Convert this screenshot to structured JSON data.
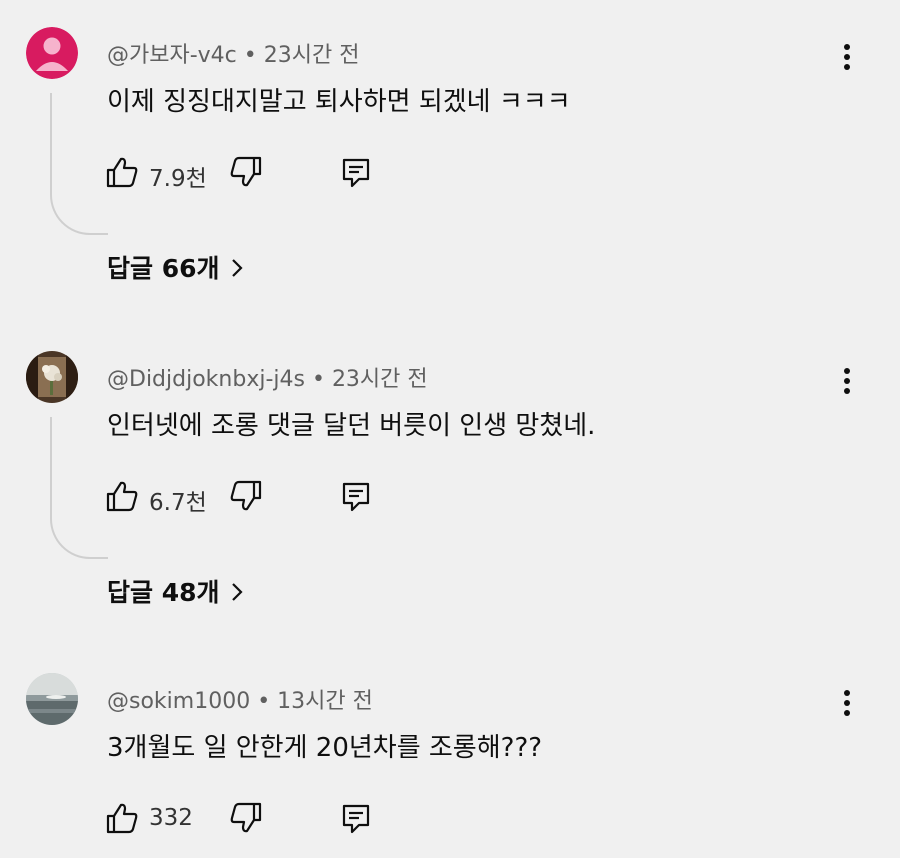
{
  "comments": [
    {
      "author": "@가보자-v4c",
      "time": "23시간 전",
      "text": "이제 징징대지말고 퇴사하면 되겠네 ㅋㅋㅋ",
      "likes": "7.9천",
      "replies": "답글 66개",
      "avatar": "default-person-avatar",
      "avatar_color": "#d81b60"
    },
    {
      "author": "@Didjdjoknbxj-j4s",
      "time": "23시간 전",
      "text": "인터넷에 조롱 댓글 달던 버릇이 인생 망쳤네.",
      "likes": "6.7천",
      "replies": "답글 48개",
      "avatar": "flower-photo-avatar"
    },
    {
      "author": "@sokim1000",
      "time": "13시간 전",
      "text": "3개월도 일 안한게 20년차를 조롱해???",
      "likes": "332",
      "avatar": "sea-photo-avatar"
    }
  ],
  "separator": " • ",
  "icons": {
    "like": "thumbs-up-icon",
    "dislike": "thumbs-down-icon",
    "reply": "reply-comment-icon",
    "more": "more-vertical-icon",
    "chevron": "chevron-right-icon"
  }
}
